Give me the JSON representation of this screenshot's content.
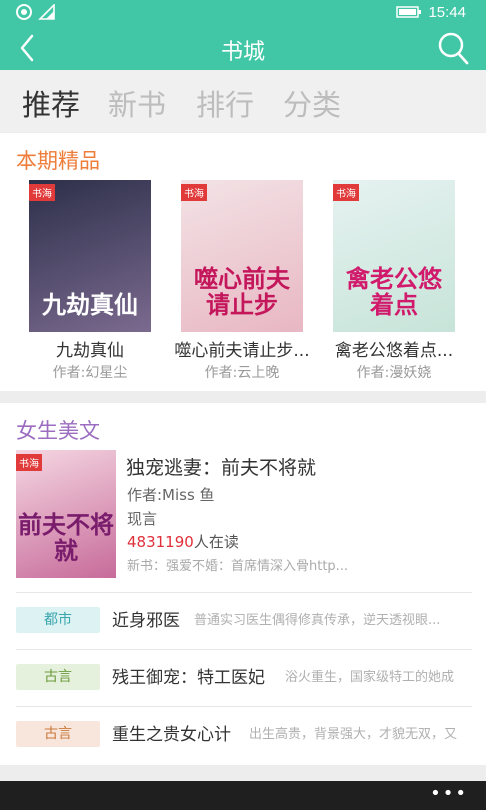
{
  "status_bar": {
    "time": "15:44"
  },
  "header": {
    "title": "书城"
  },
  "tabs": [
    {
      "label": "推荐",
      "active": true
    },
    {
      "label": "新书",
      "active": false
    },
    {
      "label": "排行",
      "active": false
    },
    {
      "label": "分类",
      "active": false
    }
  ],
  "featured": {
    "title": "本期精品",
    "books": [
      {
        "name": "九劫真仙",
        "author": "作者:幻星尘",
        "cover_text": "九劫真仙",
        "cover_tag": "书海",
        "cover_colors": [
          "#2c2f4a",
          "#7b6a8f"
        ],
        "cover_text_color": "#ffffff"
      },
      {
        "name": "噬心前夫请止步...",
        "author": "作者:云上晚",
        "cover_text": "噬心前夫请止步",
        "cover_tag": "书海",
        "cover_colors": [
          "#f3e3e6",
          "#e8b7c3"
        ],
        "cover_text_color": "#c4165a"
      },
      {
        "name": "禽老公悠着点...",
        "author": "作者:漫妖娆",
        "cover_text": "禽老公悠着点",
        "cover_tag": "书海",
        "cover_colors": [
          "#e6f2f0",
          "#c7e4d9"
        ],
        "cover_text_color": "#d11a6b"
      }
    ]
  },
  "women": {
    "title": "女生美文",
    "feature": {
      "title": "独宠逃妻：前夫不将就",
      "author": "作者:Miss 鱼",
      "genre": "现言",
      "readers_count": "4831190",
      "readers_suffix": "人在读",
      "new_book": "新书：强爱不婚：首席情深入骨http...",
      "cover_text": "前夫不将就",
      "cover_tag": "书海",
      "cover_colors": [
        "#f5d7e2",
        "#c76b9a"
      ],
      "cover_text_color": "#7a1c6c"
    },
    "list": [
      {
        "tag": "都市",
        "tag_bg": "#ddf2f3",
        "tag_color": "#3aa6ad",
        "title": "近身邪医",
        "desc": "普通实习医生偶得修真传承，逆天透视眼..."
      },
      {
        "tag": "古言",
        "tag_bg": "#e5f1dc",
        "tag_color": "#6a9b3c",
        "title": "残王御宠：特工医妃",
        "desc": "浴火重生，国家级特工的她成"
      },
      {
        "tag": "古言",
        "tag_bg": "#f8e6dc",
        "tag_color": "#c9793c",
        "title": "重生之贵女心计",
        "desc": "出生高贵，背景强大，才貌无双，又"
      }
    ]
  },
  "appbar": {
    "more_label": "•••"
  },
  "colors": {
    "accent": "#42c7a6",
    "featured_title": "#ef7d3a",
    "women_title": "#9b6cc0",
    "reader_count": "#e0303a"
  }
}
